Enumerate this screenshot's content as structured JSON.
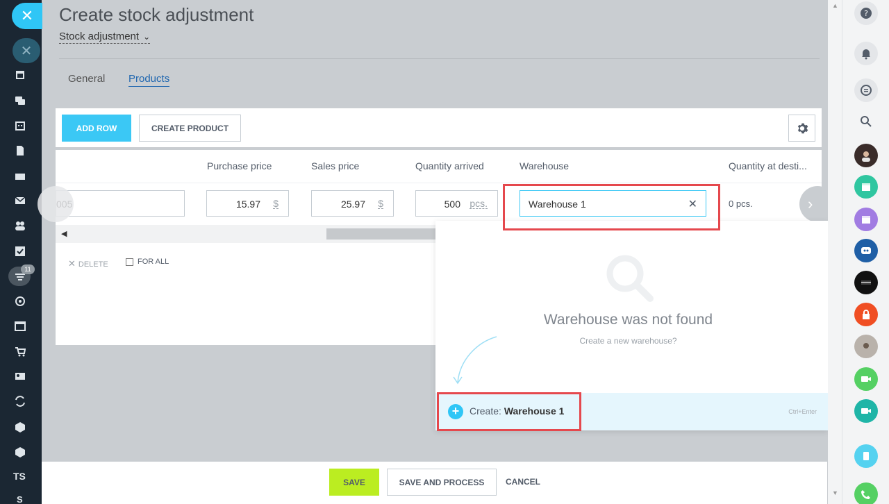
{
  "header": {
    "title": "Create stock adjustment",
    "document_type": "Stock adjustment"
  },
  "tabs": [
    {
      "label": "General"
    },
    {
      "label": "Products"
    }
  ],
  "toolbar": {
    "add_row_label": "ADD ROW",
    "create_product_label": "CREATE PRODUCT"
  },
  "table": {
    "columns": [
      "Purchase price",
      "Sales price",
      "Quantity arrived",
      "Warehouse",
      "Quantity at desti..."
    ],
    "row": {
      "partial_value": "005",
      "purchase_price": "15.97",
      "purchase_currency": "$",
      "sales_price": "25.97",
      "sales_currency": "$",
      "quantity_arrived": "500",
      "quantity_unit": "pcs.",
      "warehouse": "Warehouse 1",
      "quantity_at_destination": "0 pcs."
    },
    "delete_label": "DELETE",
    "for_all_label": "FOR ALL"
  },
  "popup": {
    "not_found_title": "Warehouse was not found",
    "not_found_subtitle": "Create a new warehouse?",
    "create_prefix": "Create:",
    "create_value": "Warehouse 1",
    "hotkey": "Ctrl+Enter"
  },
  "footer": {
    "save_label": "SAVE",
    "save_process_label": "SAVE AND PROCESS",
    "cancel_label": "CANCEL"
  },
  "leftbar": {
    "badge_count": "11",
    "ts_label": "TS",
    "s_label": "S"
  },
  "colors": {
    "accent": "#2fc6f6",
    "save_green": "#bbed21",
    "highlight_red": "#e5484d",
    "sidebar_dark": "#1b2733"
  }
}
